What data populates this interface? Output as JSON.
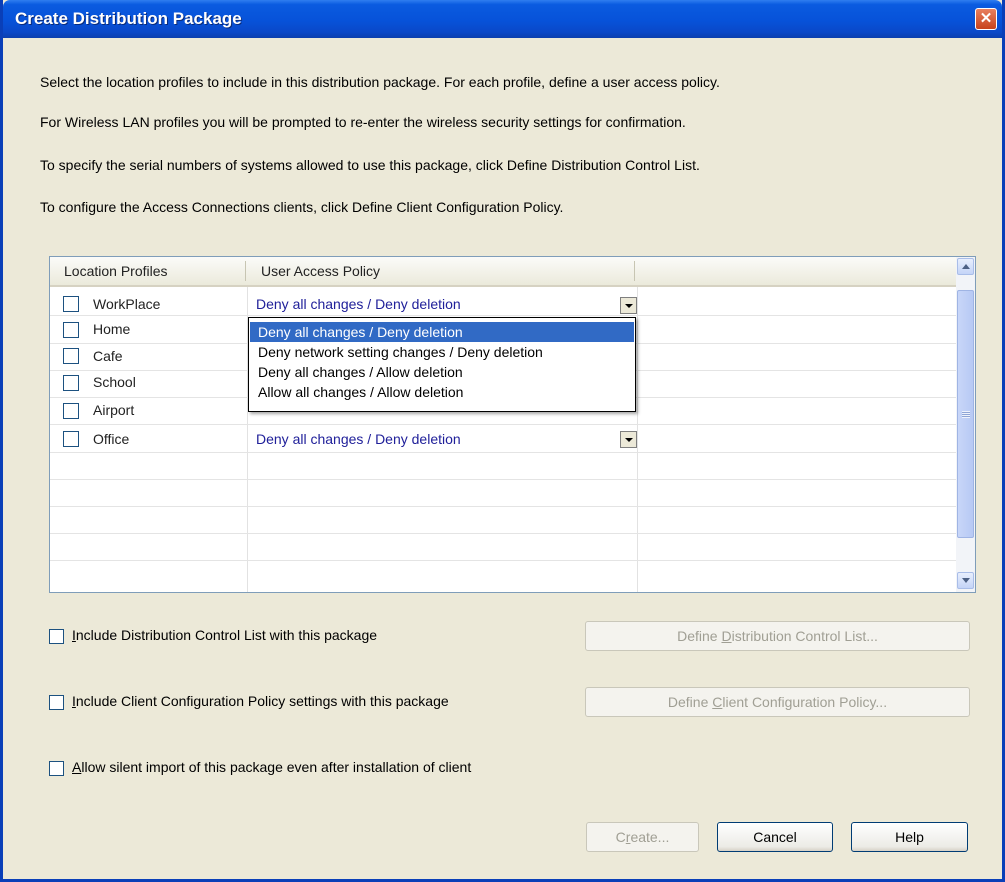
{
  "window": {
    "title": "Create Distribution Package",
    "close_glyph": "✕"
  },
  "instructions": [
    "Select the location profiles to include in this distribution package. For each profile, define a user access policy.",
    "For Wireless LAN profiles you will be prompted to re-enter the wireless security settings for confirmation.",
    "To specify the serial numbers of systems allowed to use this package, click Define Distribution Control List.",
    "To configure the Access Connections clients, click Define Client Configuration Policy."
  ],
  "grid": {
    "columns": [
      "Location Profiles",
      "User Access Policy"
    ],
    "rows": [
      {
        "name": "WorkPlace",
        "policy": "Deny all changes / Deny deletion"
      },
      {
        "name": "Home",
        "policy": ""
      },
      {
        "name": "Cafe",
        "policy": ""
      },
      {
        "name": "School",
        "policy": ""
      },
      {
        "name": "Airport",
        "policy": ""
      },
      {
        "name": "Office",
        "policy": "Deny all changes / Deny deletion"
      }
    ],
    "dropdown_options": [
      "Deny all changes / Deny deletion",
      "Deny network setting changes / Deny deletion",
      "Deny all changes / Allow deletion",
      "Allow all changes / Allow deletion"
    ],
    "dropdown_selected": "Deny all changes / Deny deletion"
  },
  "options": {
    "dcl": {
      "first": "I",
      "rest": "nclude Distribution Control List with this package",
      "checked": false
    },
    "ccp": {
      "first": "I",
      "rest": "nclude Client Configuration Policy settings with this package",
      "checked": false
    },
    "silent": {
      "first": "A",
      "rest": "llow silent import of this package even after installation of client",
      "checked": false
    }
  },
  "buttons": {
    "define_dcl": {
      "pre": "Define ",
      "key": "D",
      "post": "istribution Control List..."
    },
    "define_ccp": {
      "pre": "Define ",
      "key": "C",
      "post": "lient Configuration Policy..."
    },
    "create": {
      "pre": "C",
      "key": "r",
      "post": "eate..."
    },
    "cancel": "Cancel",
    "help": "Help"
  }
}
